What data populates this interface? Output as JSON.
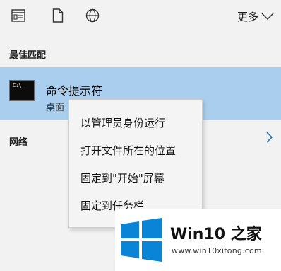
{
  "toolbar": {
    "icons": [
      "apps-filter-icon",
      "document-filter-icon",
      "web-filter-icon"
    ],
    "more_label": "更多"
  },
  "best_match": {
    "heading": "最佳匹配",
    "result": {
      "title": "命令提示符",
      "subtitle": "桌面",
      "icon_text": "C:\\_"
    }
  },
  "network": {
    "heading": "网络"
  },
  "context_menu": {
    "items": [
      "以管理员身份运行",
      "打开文件所在的位置",
      "固定到\"开始\"屏幕",
      "固定到任务栏"
    ]
  },
  "watermark": {
    "title": "Win10 之家",
    "url": "www.win10xitong.com"
  },
  "colors": {
    "selected_row": "#aacfee",
    "logo_blue": "#0a84d6",
    "accent_blue": "#1e73be"
  }
}
